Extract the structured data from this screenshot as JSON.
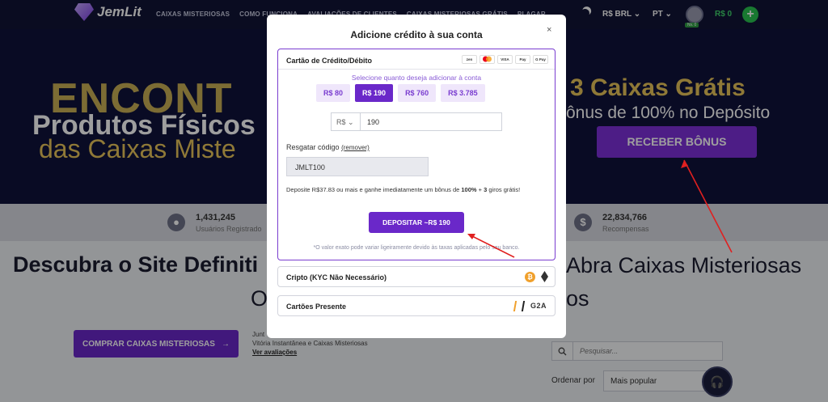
{
  "nav": {
    "brand": "JemLit",
    "links": [
      "CAIXAS MISTERIOSAS",
      "COMO FUNCIONA",
      "AVALIAÇÕES DE CLIENTES",
      "CAIXAS MISTERIOSAS GRÁTIS",
      "PLAGAR"
    ],
    "currency": "R$ BRL",
    "language": "PT",
    "level": "Nv. 0",
    "balance": "R$ 0",
    "plus": "+"
  },
  "hero": {
    "left_line1": "ENCONT",
    "left_line2": "Produtos Físicos",
    "left_line3": "das Caixas Miste",
    "right_line1": "3 Caixas Grátis",
    "right_line2": "ônus de 100% no Depósito",
    "bonus_button": "RECEBER BÔNUS"
  },
  "stats": [
    {
      "value": "1,431,245",
      "label": "Usuários Registrado"
    },
    {
      "value": "22,834,766",
      "label": "Recompensas"
    }
  ],
  "main": {
    "headline_left": "Descubra o Site Definiti",
    "headline_right": "Abra Caixas Misteriosas",
    "headline2_left": "O",
    "headline2_right": "os",
    "buy_button": "COMPRAR CAIXAS MISTERIOSAS",
    "join_text_1": "Junt",
    "join_text_2": "Vitória Instantânea e Caixas Misteriosas",
    "reviews_link": "Ver avaliações",
    "search_placeholder": "Pesquisar...",
    "sort_label": "Ordenar por",
    "sort_value": "Mais popular"
  },
  "modal": {
    "title": "Adicione crédito à sua conta",
    "close": "×",
    "card_panel": {
      "header": "Cartão de Crédito/Débito",
      "payment_icons": [
        "zen",
        "mastercard",
        "VISA",
        "Pay",
        "G Pay"
      ],
      "select_label": "Selecione quanto deseja adicionar à conta",
      "amounts": [
        "R$ 80",
        "R$ 190",
        "R$ 760",
        "R$ 3.785"
      ],
      "selected_amount": "R$ 190",
      "currency_select": "R$",
      "amount_value": "190",
      "redeem_label": "Resgatar código",
      "remove_link": "(remover)",
      "code_value": "JMLT100",
      "promo_prefix": "Deposite R$37.83 ou mais e ganhe imediatamente um bônus de ",
      "promo_bold1": "100%",
      "promo_mid": " + ",
      "promo_bold2": "3",
      "promo_suffix": " giros grátis!",
      "deposit_button": "DEPOSITAR ~R$ 190",
      "note": "*O valor exato pode variar ligeiramente devido às taxas aplicadas pelo seu banco."
    },
    "methods": [
      {
        "label": "Cripto (KYC Não Necessário)"
      },
      {
        "label": "Cartões Presente"
      }
    ],
    "g2a": "G2A"
  },
  "colors": {
    "accent": "#6a28c9",
    "nav_bg": "#111436",
    "annotation_red": "#e02020"
  }
}
